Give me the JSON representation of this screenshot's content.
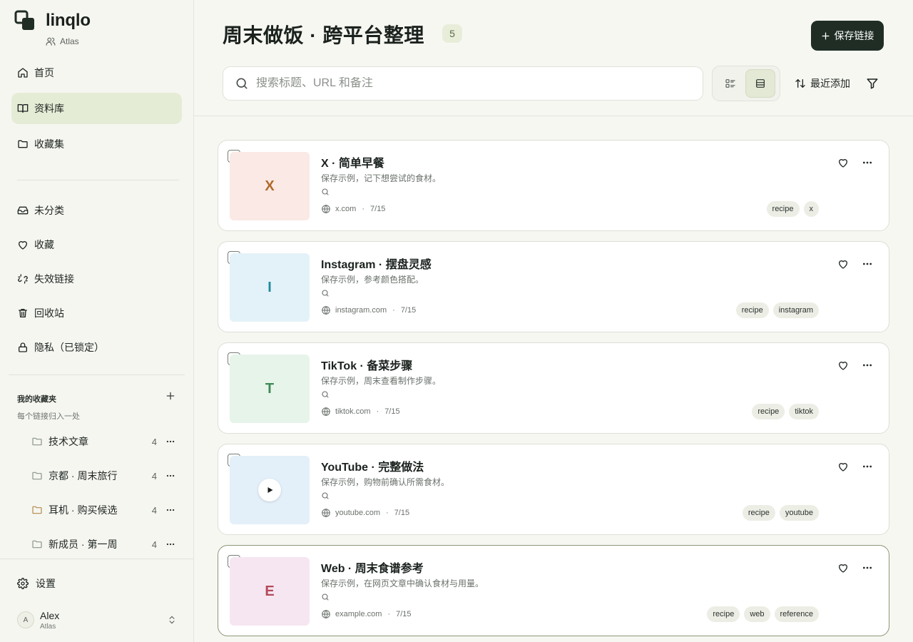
{
  "app": {
    "name": "linqlo",
    "workspace": "Atlas"
  },
  "sidebar": {
    "nav": [
      {
        "label": "首页",
        "icon": "home-icon"
      },
      {
        "label": "资料库",
        "icon": "book-icon",
        "active": true
      },
      {
        "label": "收藏集",
        "icon": "folder-icon"
      }
    ],
    "nav2": [
      {
        "label": "未分类",
        "icon": "inbox-icon"
      },
      {
        "label": "收藏",
        "icon": "heart-icon"
      },
      {
        "label": "失效链接",
        "icon": "broken-link-icon"
      },
      {
        "label": "回收站",
        "icon": "trash-icon"
      },
      {
        "label": "隐私（已锁定）",
        "icon": "lock-icon"
      }
    ],
    "folders": {
      "title": "我的收藏夹",
      "subtitle": "每个链接归入一处",
      "items": [
        {
          "name": "技术文章",
          "count": "4",
          "color": "#8a948c"
        },
        {
          "name": "京都 · 周末旅行",
          "count": "4",
          "color": "#8a948c"
        },
        {
          "name": "耳机 · 购买候选",
          "count": "4",
          "color": "#b38a4a"
        },
        {
          "name": "新成员 · 第一周",
          "count": "4",
          "color": "#8a948c"
        }
      ]
    },
    "settings_label": "设置",
    "user": {
      "initial": "A",
      "name": "Alex",
      "workspace": "Atlas"
    }
  },
  "header": {
    "title": "周末做饭 · 跨平台整理",
    "count": "5",
    "save_label": "保存链接",
    "search_placeholder": "搜索标题、URL 和备注",
    "sort_label": "最近添加"
  },
  "cards": [
    {
      "title": "X · 简单早餐",
      "desc": "保存示例，记下想尝试的食材。",
      "domain": "x.com",
      "date": "7/15",
      "tags": [
        "recipe",
        "x"
      ],
      "thumb": "X",
      "thumb_bg": "#fae9e5",
      "thumb_fg": "#b06a2c"
    },
    {
      "title": "Instagram · 摆盘灵感",
      "desc": "保存示例，参考颜色搭配。",
      "domain": "instagram.com",
      "date": "7/15",
      "tags": [
        "recipe",
        "instagram"
      ],
      "thumb": "I",
      "thumb_bg": "#e3f2f8",
      "thumb_fg": "#1f8aa0"
    },
    {
      "title": "TikTok · 备菜步骤",
      "desc": "保存示例，周末查看制作步骤。",
      "domain": "tiktok.com",
      "date": "7/15",
      "tags": [
        "recipe",
        "tiktok"
      ],
      "thumb": "T",
      "thumb_bg": "#e6f4ea",
      "thumb_fg": "#3d8a55"
    },
    {
      "title": "YouTube · 完整做法",
      "desc": "保存示例，购物前确认所需食材。",
      "domain": "youtube.com",
      "date": "7/15",
      "tags": [
        "recipe",
        "youtube"
      ],
      "thumb": "",
      "thumb_bg": "#e3eff9",
      "thumb_fg": "#1b1b1b",
      "play": true
    },
    {
      "title": "Web · 周末食谱参考",
      "desc": "保存示例，在网页文章中确认食材与用量。",
      "domain": "example.com",
      "date": "7/15",
      "tags": [
        "recipe",
        "web",
        "reference"
      ],
      "thumb": "E",
      "thumb_bg": "#f6e6f2",
      "thumb_fg": "#b34a5a",
      "selected": true
    }
  ]
}
